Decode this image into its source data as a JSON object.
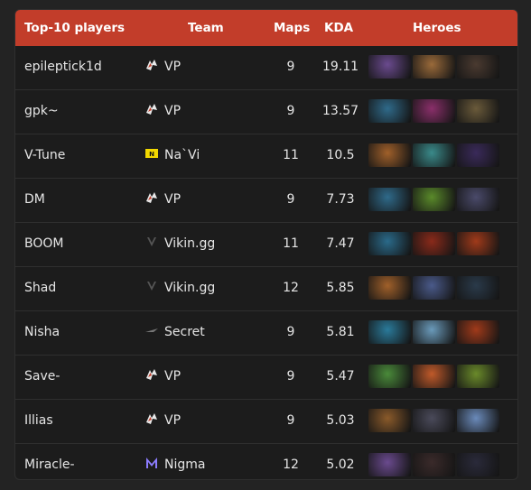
{
  "header": {
    "player": "Top-10 players",
    "team": "Team",
    "maps": "Maps",
    "kda": "KDA",
    "heroes": "Heroes"
  },
  "rows": [
    {
      "player": "epileptick1d",
      "team": "VP",
      "team_logo": "vp-logo-icon",
      "maps": "9",
      "kda": "19.11",
      "heroes": [
        {
          "icon": "hero-icon",
          "color": "#6a4a8e"
        },
        {
          "icon": "hero-icon",
          "color": "#9a6a3a"
        },
        {
          "icon": "hero-icon",
          "color": "#4a3a30"
        }
      ]
    },
    {
      "player": "gpk~",
      "team": "VP",
      "team_logo": "vp-logo-icon",
      "maps": "9",
      "kda": "13.57",
      "heroes": [
        {
          "icon": "hero-icon",
          "color": "#2f6a8a"
        },
        {
          "icon": "hero-icon",
          "color": "#8a2f6a"
        },
        {
          "icon": "hero-icon",
          "color": "#6a5a3a"
        }
      ]
    },
    {
      "player": "V-Tune",
      "team": "Na`Vi",
      "team_logo": "navi-logo-icon",
      "maps": "11",
      "kda": "10.5",
      "heroes": [
        {
          "icon": "hero-icon",
          "color": "#a0602a"
        },
        {
          "icon": "hero-icon",
          "color": "#3a8a8a"
        },
        {
          "icon": "hero-icon",
          "color": "#3a2a5a"
        }
      ]
    },
    {
      "player": "DM",
      "team": "VP",
      "team_logo": "vp-logo-icon",
      "maps": "9",
      "kda": "7.73",
      "heroes": [
        {
          "icon": "hero-icon",
          "color": "#2f6a8a"
        },
        {
          "icon": "hero-icon",
          "color": "#5a8a2a"
        },
        {
          "icon": "hero-icon",
          "color": "#4a4a6a"
        }
      ]
    },
    {
      "player": "BOOM",
      "team": "Vikin.gg",
      "team_logo": "vikin-logo-icon",
      "maps": "11",
      "kda": "7.47",
      "heroes": [
        {
          "icon": "hero-icon",
          "color": "#2a6a8a"
        },
        {
          "icon": "hero-icon",
          "color": "#8a2a1a"
        },
        {
          "icon": "hero-icon",
          "color": "#a03a1a"
        }
      ]
    },
    {
      "player": "Shad",
      "team": "Vikin.gg",
      "team_logo": "vikin-logo-icon",
      "maps": "12",
      "kda": "5.85",
      "heroes": [
        {
          "icon": "hero-icon",
          "color": "#a0602a"
        },
        {
          "icon": "hero-icon",
          "color": "#4a5a8a"
        },
        {
          "icon": "hero-icon",
          "color": "#2a3a4a"
        }
      ]
    },
    {
      "player": "Nisha",
      "team": "Secret",
      "team_logo": "secret-logo-icon",
      "maps": "9",
      "kda": "5.81",
      "heroes": [
        {
          "icon": "hero-icon",
          "color": "#2a7a9a"
        },
        {
          "icon": "hero-icon",
          "color": "#6a9aba"
        },
        {
          "icon": "hero-icon",
          "color": "#a03a1a"
        }
      ]
    },
    {
      "player": "Save-",
      "team": "VP",
      "team_logo": "vp-logo-icon",
      "maps": "9",
      "kda": "5.47",
      "heroes": [
        {
          "icon": "hero-icon",
          "color": "#4a8a3a"
        },
        {
          "icon": "hero-icon",
          "color": "#c05a2a"
        },
        {
          "icon": "hero-icon",
          "color": "#6a8a2a"
        }
      ]
    },
    {
      "player": "Illias",
      "team": "VP",
      "team_logo": "vp-logo-icon",
      "maps": "9",
      "kda": "5.03",
      "heroes": [
        {
          "icon": "hero-icon",
          "color": "#8a5a2a"
        },
        {
          "icon": "hero-icon",
          "color": "#4a4a5a"
        },
        {
          "icon": "hero-icon",
          "color": "#6a8aba"
        }
      ]
    },
    {
      "player": "Miracle-",
      "team": "Nigma",
      "team_logo": "nigma-logo-icon",
      "maps": "12",
      "kda": "5.02",
      "heroes": [
        {
          "icon": "hero-icon",
          "color": "#6a4a8e"
        },
        {
          "icon": "hero-icon",
          "color": "#3a2a2a"
        },
        {
          "icon": "hero-icon",
          "color": "#2a2a3a"
        }
      ]
    }
  ],
  "colors": {
    "header_bg": "#c23d2a",
    "panel_bg": "#1c1c1c",
    "page_bg": "#232323"
  }
}
